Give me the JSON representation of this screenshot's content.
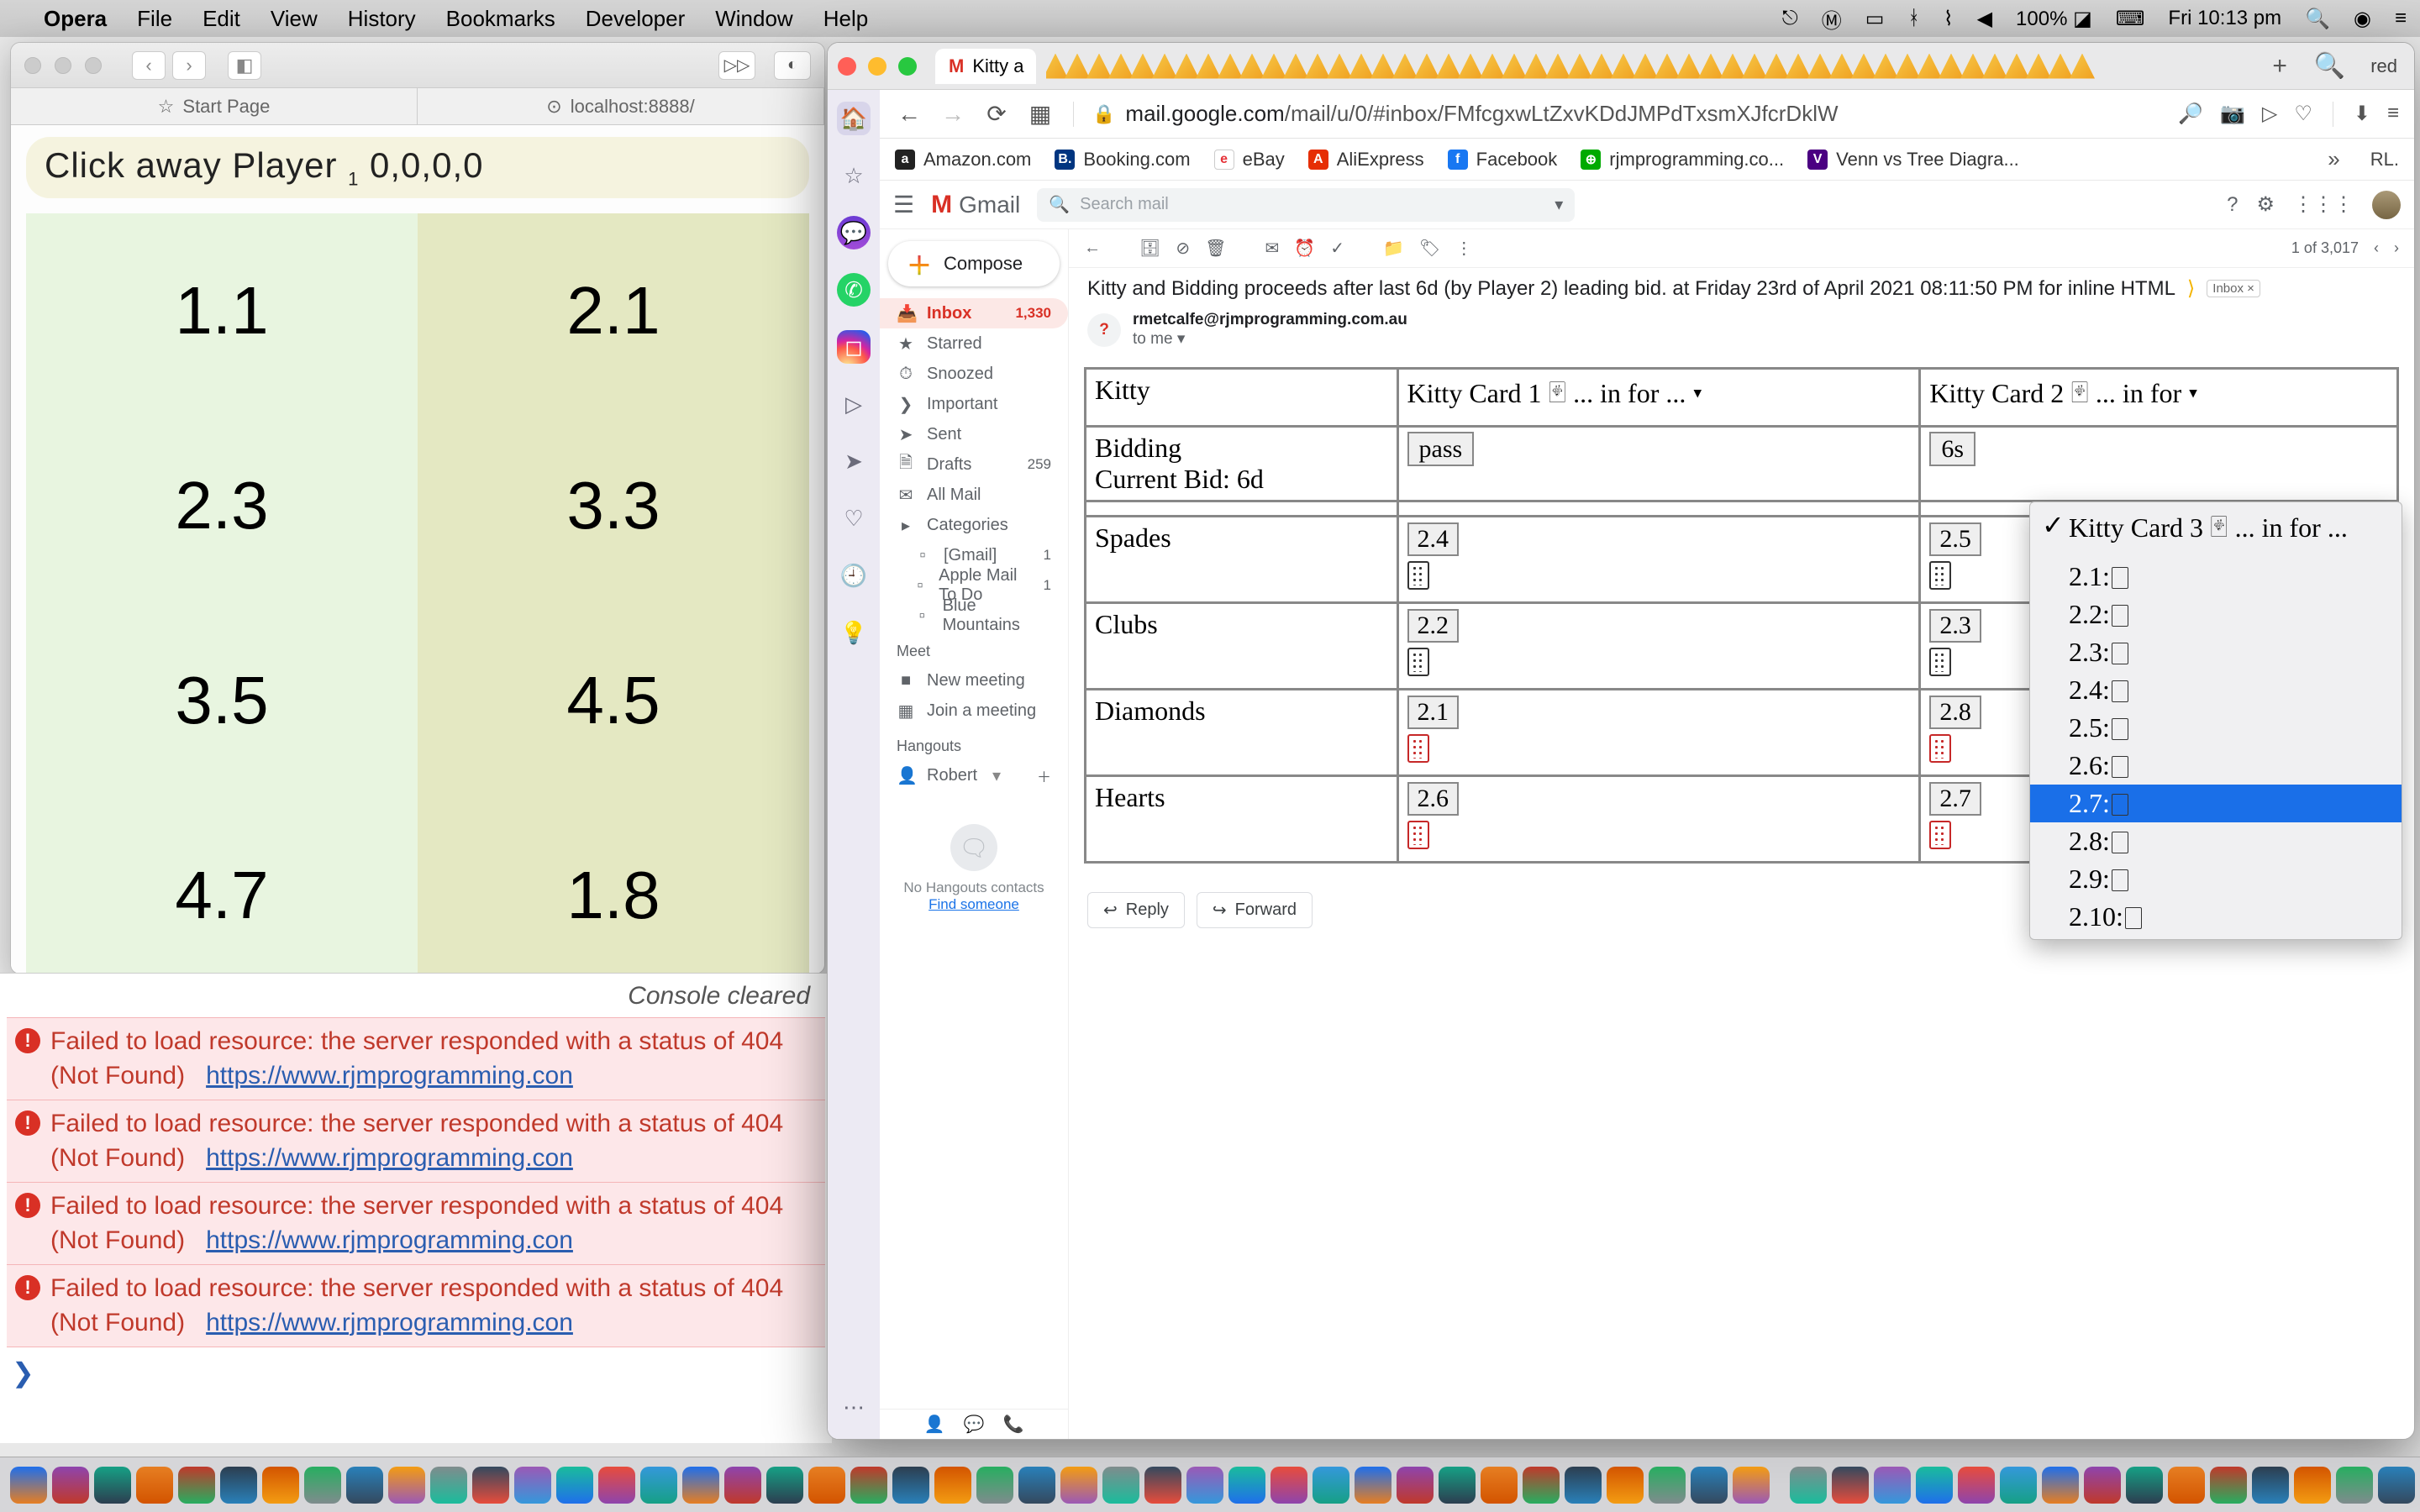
{
  "menubar": {
    "app": "Opera",
    "items": [
      "File",
      "Edit",
      "View",
      "History",
      "Bookmarks",
      "Developer",
      "Window",
      "Help"
    ],
    "battery": "100%",
    "clock": "Fri 10:13 pm"
  },
  "bg_window": {
    "tabs": {
      "start": "Start Page",
      "local": "localhost:8888/"
    },
    "banner_pre": "Click away Player ",
    "banner_sub": "1",
    "banner_post": " 0,0,0,0",
    "grid": [
      "1.1",
      "2.1",
      "2.3",
      "3.3",
      "3.5",
      "4.5",
      "4.7",
      "1.8"
    ]
  },
  "console": {
    "cleared": "Console cleared",
    "err_text": "Failed to load resource: the server responded with a status of 404 (Not Found)",
    "err_link": "https://www.rjmprogramming.con"
  },
  "opera": {
    "tab_title": "Kitty a",
    "newtab": "+",
    "right_label": "red",
    "addr": {
      "domain": "mail.google.com",
      "path": "/mail/u/0/#inbox/FMfcgxwLtZxvKDdJMPdTxsmXJfcrDklW"
    },
    "bookmarks": [
      "Amazon.com",
      "Booking.com",
      "eBay",
      "AliExpress",
      "Facebook",
      "rjmprogramming.co...",
      "Venn vs Tree Diagra..."
    ],
    "truncated": "RL."
  },
  "gmail": {
    "brand": "Gmail",
    "search_ph": "Search mail",
    "compose": "Compose",
    "nav": [
      {
        "label": "Inbox",
        "count": "1,330",
        "sel": true,
        "icon": "📥"
      },
      {
        "label": "Starred",
        "icon": "★"
      },
      {
        "label": "Snoozed",
        "icon": "⏱"
      },
      {
        "label": "Important",
        "icon": "❯"
      },
      {
        "label": "Sent",
        "icon": "➤"
      },
      {
        "label": "Drafts",
        "count": "259",
        "icon": "🗎"
      },
      {
        "label": "All Mail",
        "icon": "✉"
      },
      {
        "label": "Categories",
        "icon": "▸"
      },
      {
        "label": "[Gmail]",
        "count": "1",
        "sub": true
      },
      {
        "label": "Apple Mail To Do",
        "count": "1",
        "sub": true
      },
      {
        "label": "Blue Mountains",
        "sub": true
      }
    ],
    "meet_hdr": "Meet",
    "meet": [
      {
        "label": "New meeting",
        "icon": "■"
      },
      {
        "label": "Join a meeting",
        "icon": "▦"
      }
    ],
    "hangouts_hdr": "Hangouts",
    "hangouts_user": "Robert",
    "nohangouts": "No Hangouts contacts",
    "findsomeone": "Find someone",
    "counter": "1 of 3,017",
    "subject": "Kitty and Bidding proceeds after last 6d (by Player 2) leading bid. at Friday 23rd of April 2021 08:11:50 PM for inline HTML",
    "inbox_chip": "Inbox ×",
    "from": "rmetcalfe@rjmprogramming.com.au",
    "to": "to me",
    "reply": "Reply",
    "forward": "Forward"
  },
  "kitty": {
    "headers": [
      "Kitty",
      "Kitty Card 1 🂿 ... in for ... ▾",
      "Kitty Card 2 🂿 ... in for ▾"
    ],
    "bidding_label": "Bidding",
    "current_label": "Current Bid: 6d",
    "pass": "pass",
    "bid2": "6s",
    "rows": [
      {
        "suit": "Spades",
        "c1": "2.4",
        "c2": "2.5"
      },
      {
        "suit": "Clubs",
        "c1": "2.2",
        "c2": "2.3"
      },
      {
        "suit": "Diamonds",
        "c1": "2.1",
        "c2": "2.8",
        "red": true
      },
      {
        "suit": "Hearts",
        "c1": "2.6",
        "c2": "2.7",
        "red": true
      }
    ]
  },
  "dropdown": {
    "header": "Kitty Card 3 🂿 ... in for ...",
    "items": [
      "2.1:",
      "2.2:",
      "2.3:",
      "2.4:",
      "2.5:",
      "2.6:",
      "2.7:",
      "2.8:",
      "2.9:",
      "2.10:"
    ],
    "selected_index": 6
  }
}
